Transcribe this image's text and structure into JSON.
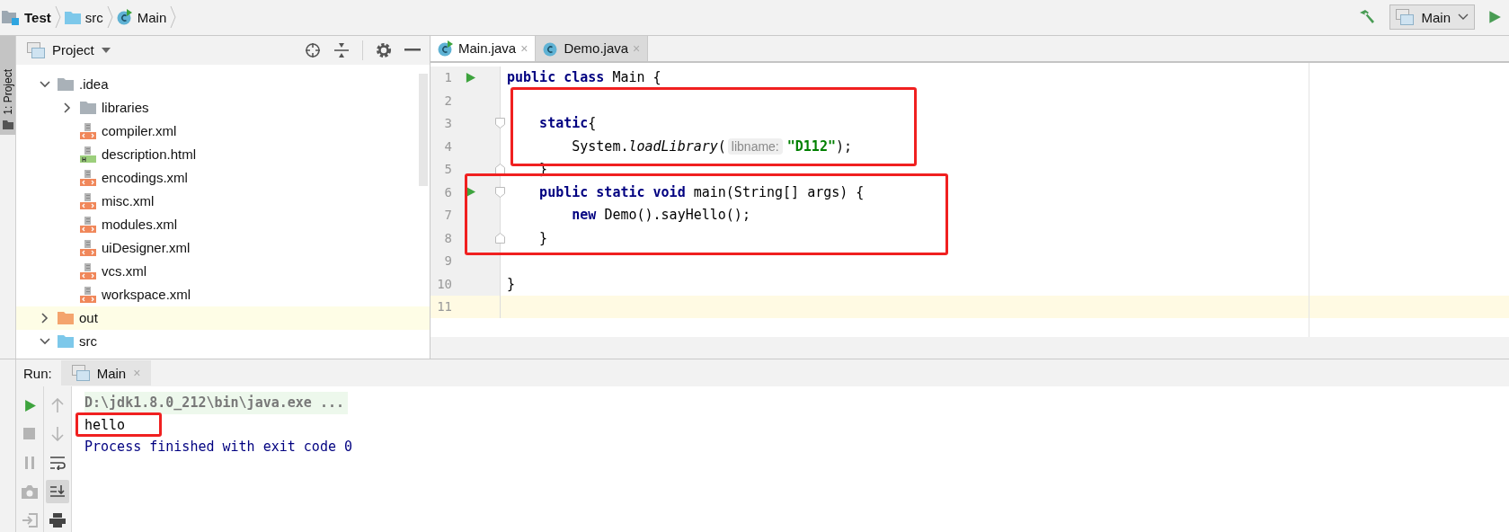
{
  "breadcrumbs": [
    {
      "label": "Test",
      "kind": "module",
      "bold": true
    },
    {
      "label": "src",
      "kind": "folder",
      "bold": false
    },
    {
      "label": "Main",
      "kind": "runnable-class",
      "bold": false
    }
  ],
  "run_config": {
    "label": "Main"
  },
  "side_tab": {
    "label": "1: Project"
  },
  "project_panel": {
    "title": "Project",
    "tree": [
      {
        "name": ".idea",
        "kind": "folder",
        "expanded": true,
        "selected": false,
        "children": [
          {
            "name": "libraries",
            "kind": "folder",
            "expanded": false,
            "selected": false
          },
          {
            "name": "compiler.xml",
            "kind": "xml",
            "selected": false
          },
          {
            "name": "description.html",
            "kind": "html",
            "selected": false
          },
          {
            "name": "encodings.xml",
            "kind": "xml",
            "selected": false
          },
          {
            "name": "misc.xml",
            "kind": "xml",
            "selected": false
          },
          {
            "name": "modules.xml",
            "kind": "xml",
            "selected": false
          },
          {
            "name": "uiDesigner.xml",
            "kind": "xml",
            "selected": false
          },
          {
            "name": "vcs.xml",
            "kind": "xml",
            "selected": false
          },
          {
            "name": "workspace.xml",
            "kind": "xml",
            "selected": false
          }
        ]
      },
      {
        "name": "out",
        "kind": "excluded-folder",
        "expanded": false,
        "selected": true
      },
      {
        "name": "src",
        "kind": "source-folder",
        "expanded": true,
        "selected": false
      }
    ]
  },
  "editor": {
    "tabs": [
      {
        "label": "Main.java",
        "kind": "runnable-class",
        "selected": true,
        "close": "×"
      },
      {
        "label": "Demo.java",
        "kind": "class",
        "selected": false,
        "close": "×"
      }
    ],
    "lines": [
      {
        "number": "1",
        "runnable": true,
        "fold_start": false,
        "fold_end": false,
        "current": false,
        "tokens": [
          {
            "kind": "keyword",
            "text": "public class "
          },
          {
            "kind": "plain",
            "text": "Main {"
          }
        ]
      },
      {
        "number": "2",
        "runnable": false,
        "fold_start": false,
        "fold_end": false,
        "current": false
      },
      {
        "number": "3",
        "runnable": false,
        "fold_start": true,
        "fold_end": false,
        "current": false,
        "tokens": [
          {
            "kind": "keyword",
            "text": "    static"
          },
          {
            "kind": "plain",
            "text": "{"
          }
        ]
      },
      {
        "number": "4",
        "runnable": false,
        "fold_start": false,
        "fold_end": false,
        "current": false,
        "tokens": [
          {
            "kind": "plain",
            "text": "        System."
          },
          {
            "kind": "method",
            "text": "loadLibrary"
          },
          {
            "kind": "plain",
            "text": "("
          },
          {
            "kind": "hint",
            "text": "libname:"
          },
          {
            "kind": "string",
            "text": "\"D112\""
          },
          {
            "kind": "plain",
            "text": ");"
          }
        ]
      },
      {
        "number": "5",
        "runnable": false,
        "fold_start": false,
        "fold_end": true,
        "current": false,
        "tokens": [
          {
            "kind": "plain",
            "text": "    }"
          }
        ]
      },
      {
        "number": "6",
        "runnable": true,
        "fold_start": true,
        "fold_end": false,
        "current": false,
        "tokens": [
          {
            "kind": "keyword",
            "text": "    public static void "
          },
          {
            "kind": "plain",
            "text": "main(String[] args) {"
          }
        ]
      },
      {
        "number": "7",
        "runnable": false,
        "fold_start": false,
        "fold_end": false,
        "current": false,
        "tokens": [
          {
            "kind": "keyword",
            "text": "        new "
          },
          {
            "kind": "plain",
            "text": "Demo().sayHello();"
          }
        ]
      },
      {
        "number": "8",
        "runnable": false,
        "fold_start": false,
        "fold_end": true,
        "current": false,
        "tokens": [
          {
            "kind": "plain",
            "text": "    }"
          }
        ]
      },
      {
        "number": "9",
        "runnable": false,
        "fold_start": false,
        "fold_end": false,
        "current": false
      },
      {
        "number": "10",
        "runnable": false,
        "fold_start": false,
        "fold_end": false,
        "current": false,
        "tokens": [
          {
            "kind": "plain",
            "text": "}"
          }
        ]
      },
      {
        "number": "11",
        "runnable": false,
        "fold_start": false,
        "fold_end": false,
        "current": true
      }
    ]
  },
  "run_panel": {
    "label": "Run:",
    "tabs": [
      {
        "label": "Main",
        "selected": true,
        "close": "×"
      }
    ],
    "tools": [
      {
        "kind": "rerun",
        "disabled": false
      },
      {
        "kind": "stop",
        "disabled": true
      },
      {
        "kind": "pause",
        "disabled": true
      },
      {
        "kind": "camera",
        "disabled": true
      },
      {
        "kind": "exit",
        "disabled": true
      }
    ],
    "tools2": [
      {
        "kind": "up",
        "disabled": true,
        "on": false
      },
      {
        "kind": "down",
        "disabled": true,
        "on": false
      },
      {
        "kind": "wrap",
        "disabled": false,
        "on": false
      },
      {
        "kind": "scroll-end",
        "disabled": false,
        "on": true
      },
      {
        "kind": "print",
        "disabled": false,
        "on": false
      }
    ],
    "output": [
      {
        "kind": "command",
        "text": "D:\\jdk1.8.0_212\\bin\\java.exe ..."
      },
      {
        "kind": "stdout",
        "text": "hello"
      },
      {
        "kind": "system",
        "text": "Process finished with exit code 0"
      }
    ]
  }
}
